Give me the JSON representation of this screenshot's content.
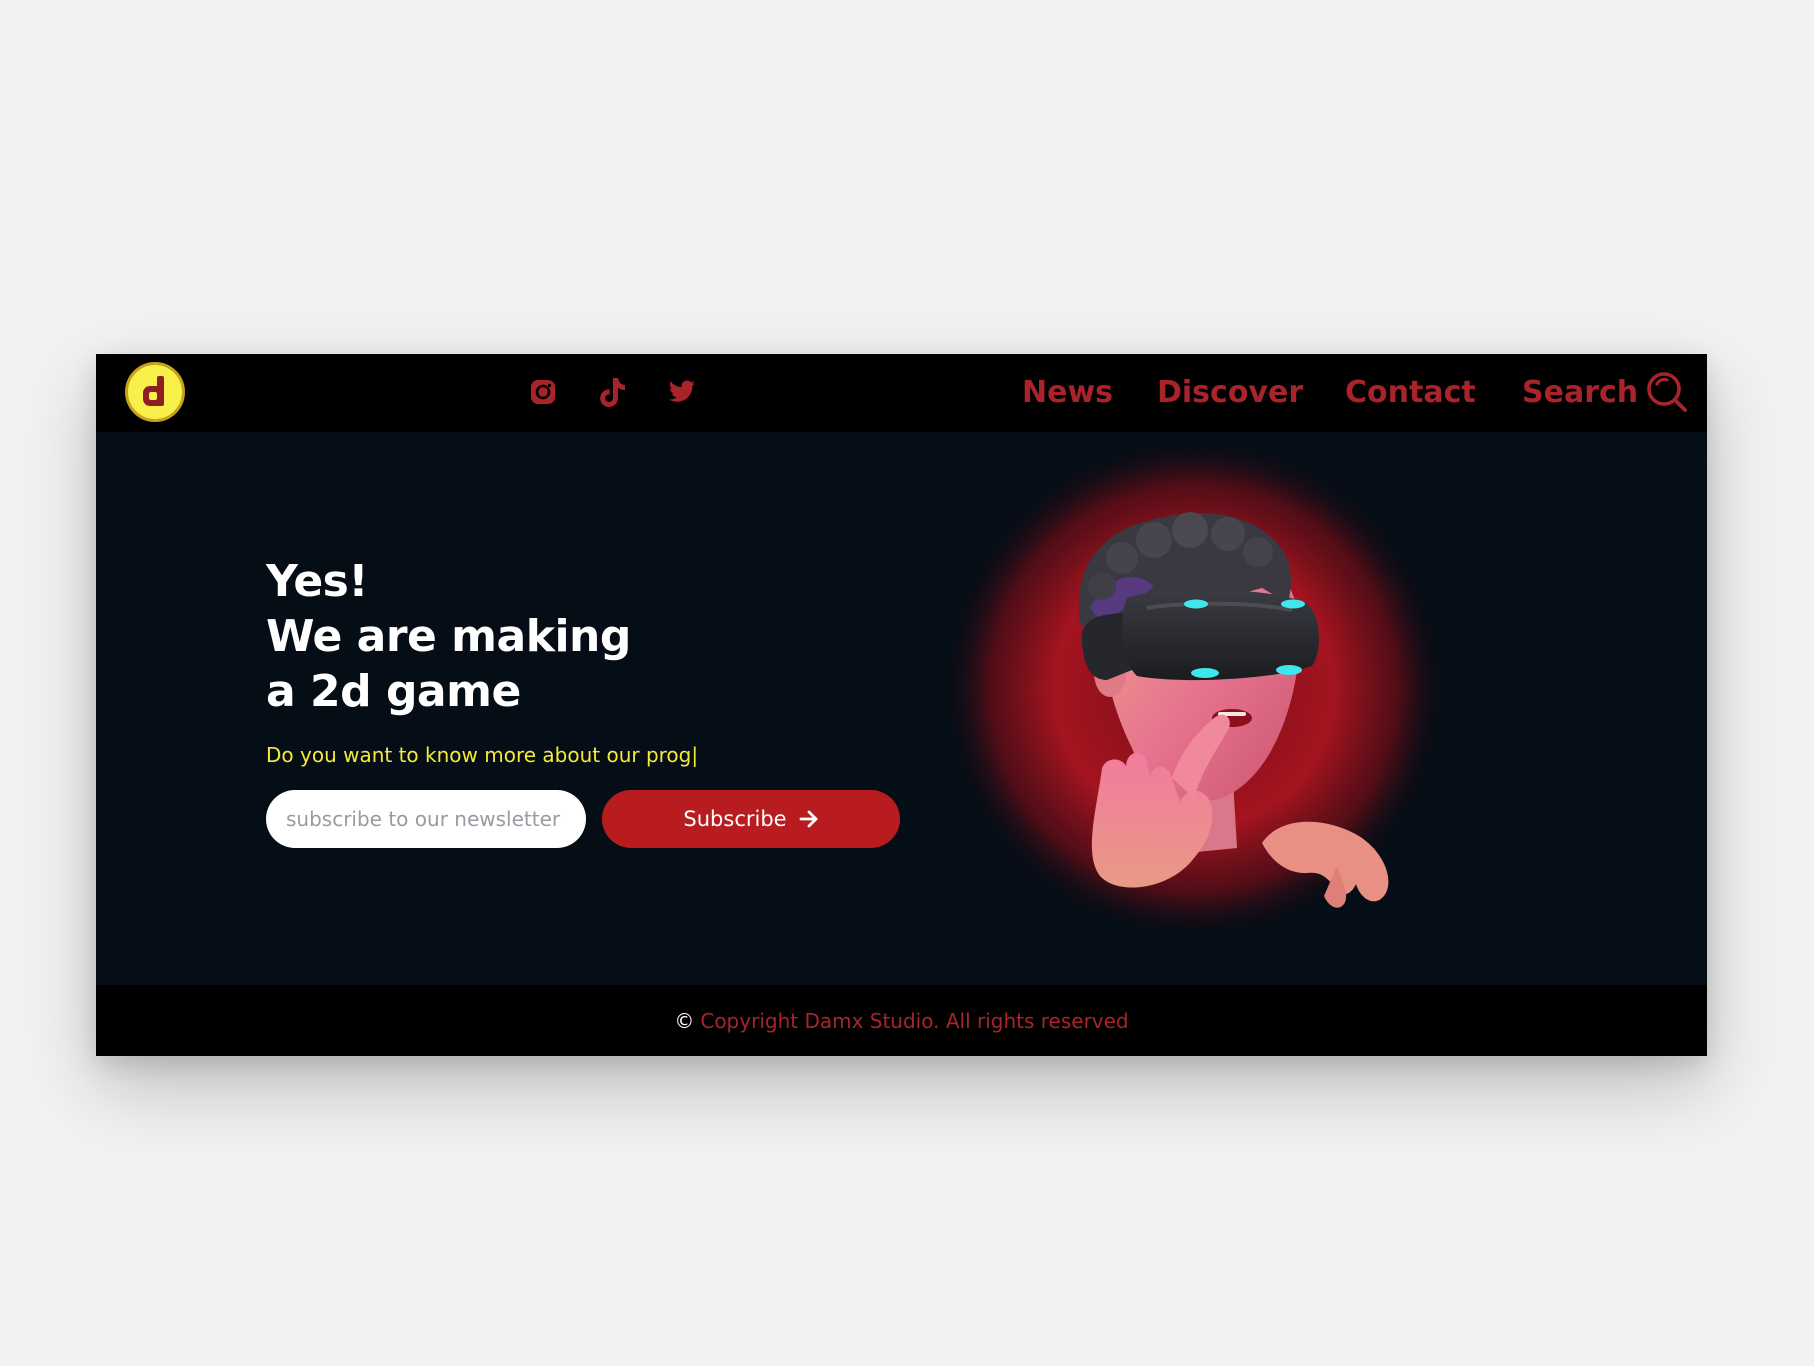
{
  "colors": {
    "page_background": "#f2f2f2",
    "hero_background": "#050d16",
    "bar_background": "#000000",
    "brand_red": "#a8242a",
    "button_red": "#b91c1f",
    "accent_yellow": "#f5ea3a",
    "logo_yellow": "#f7ef4a"
  },
  "header": {
    "logo_icon": "d-letter-logo",
    "social": [
      {
        "icon": "instagram-icon"
      },
      {
        "icon": "tiktok-icon"
      },
      {
        "icon": "twitter-icon"
      }
    ],
    "nav": {
      "news": "News",
      "discover": "Discover",
      "contact": "Contact",
      "search": "Search"
    },
    "search_icon": "search-icon"
  },
  "hero": {
    "headline_line1": "Yes!",
    "headline_line2": "We are making",
    "headline_line3": "a 2d game",
    "subtitle": "Do you want to know more about our prog|",
    "input_placeholder": "subscribe to our newsletter",
    "input_value": "",
    "subscribe_label": "Subscribe",
    "subscribe_icon": "arrow-right-icon",
    "illustration": "vr-headset-character-illustration"
  },
  "footer": {
    "copyright_symbol": "©",
    "copyright_text": "Copyright Damx Studio. All rights reserved"
  }
}
